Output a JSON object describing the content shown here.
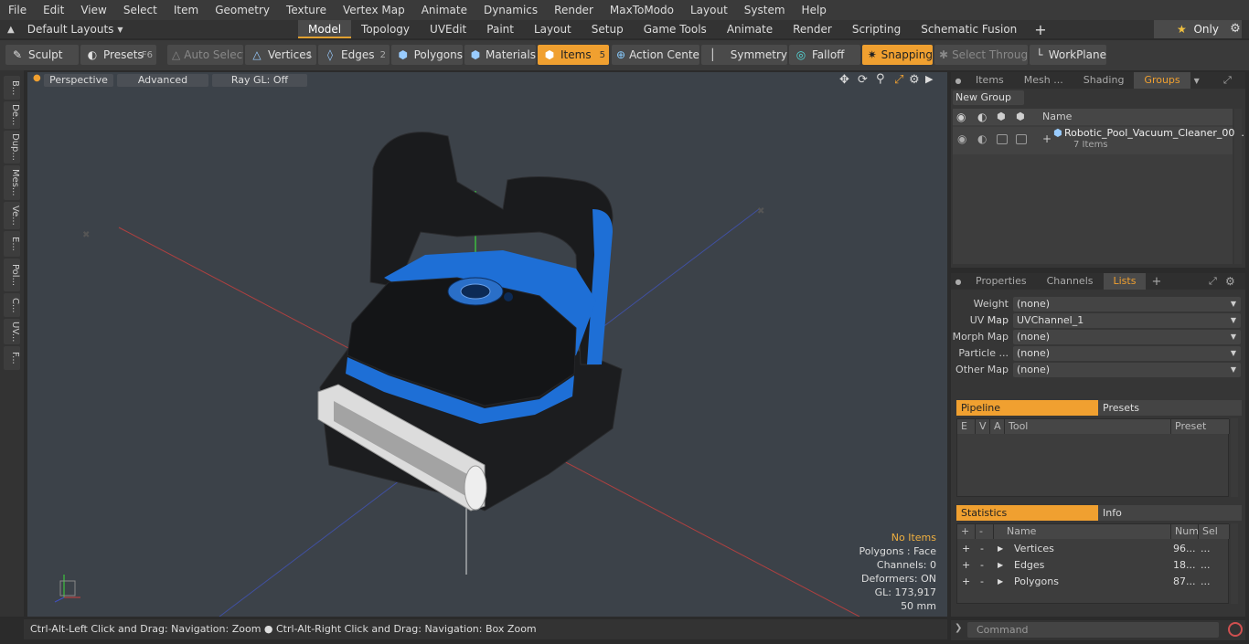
{
  "menu": [
    "File",
    "Edit",
    "View",
    "Select",
    "Item",
    "Geometry",
    "Texture",
    "Vertex Map",
    "Animate",
    "Dynamics",
    "Render",
    "MaxToModo",
    "Layout",
    "System",
    "Help"
  ],
  "layouts": {
    "label": "Default Layouts",
    "tabs": [
      "Model",
      "Topology",
      "UVEdit",
      "Paint",
      "Layout",
      "Setup",
      "Game Tools",
      "Animate",
      "Render",
      "Scripting",
      "Schematic Fusion"
    ],
    "only": "Only"
  },
  "toolbar": {
    "sculpt": "Sculpt",
    "presets": "Presets",
    "presets_key": "F6",
    "auto_select": "Auto Select",
    "vertices": "Vertices",
    "vertices_num": "1",
    "edges": "Edges",
    "edges_num": "2",
    "polygons": "Polygons",
    "materials": "Materials",
    "items": "Items",
    "items_num": "5",
    "action_center": "Action Center",
    "symmetry": "Symmetry",
    "falloff": "Falloff",
    "snapping": "Snapping",
    "select_through": "Select Through",
    "workplane": "WorkPlane"
  },
  "left_tabs": [
    "B...",
    "De...",
    "Dup...",
    "Mes...",
    "Ve...",
    "E...",
    "Pol...",
    "C...",
    "UV...",
    "F..."
  ],
  "viewport": {
    "view": "Perspective",
    "shading": "Advanced",
    "raygl": "Ray GL: Off",
    "info": {
      "items": "No Items",
      "polygons": "Polygons : Face",
      "channels": "Channels: 0",
      "deformers": "Deformers: ON",
      "gl": "GL: 173,917",
      "unit": "50 mm"
    }
  },
  "status": "Ctrl-Alt-Left Click and Drag: Navigation: Zoom ● Ctrl-Alt-Right Click and Drag: Navigation: Box Zoom",
  "groups_panel": {
    "tabs": [
      "Items",
      "Mesh ...",
      "Shading",
      "Groups"
    ],
    "new_group": "New Group",
    "name_col": "Name",
    "item_name": "Robotic_Pool_Vacuum_Cleaner_00...",
    "item_count": "7 Items"
  },
  "props_panel": {
    "tabs": [
      "Properties",
      "Channels",
      "Lists"
    ],
    "maps": [
      {
        "label": "Weight Map",
        "value": "(none)"
      },
      {
        "label": "UV Map",
        "value": "UVChannel_1"
      },
      {
        "label": "Morph Map",
        "value": "(none)"
      },
      {
        "label": "Particle ...",
        "value": "(none)"
      },
      {
        "label": "Other Map",
        "value": "(none)"
      }
    ],
    "pipeline": "Pipeline",
    "presets": "Presets",
    "pipe_cols": [
      "E",
      "V",
      "A",
      "Tool",
      "Preset"
    ],
    "statistics": "Statistics",
    "info": "Info",
    "stat_cols": [
      "+",
      "-",
      "Name",
      "Num",
      "Sel"
    ],
    "stats": [
      {
        "name": "Vertices",
        "num": "96...",
        "sel": "..."
      },
      {
        "name": "Edges",
        "num": "18...",
        "sel": "..."
      },
      {
        "name": "Polygons",
        "num": "87...",
        "sel": "..."
      }
    ]
  },
  "command": "Command",
  "colors": {
    "accent": "#f0a030",
    "robot_blue": "#1e6fd6",
    "viewport_bg": "#3c4249"
  }
}
